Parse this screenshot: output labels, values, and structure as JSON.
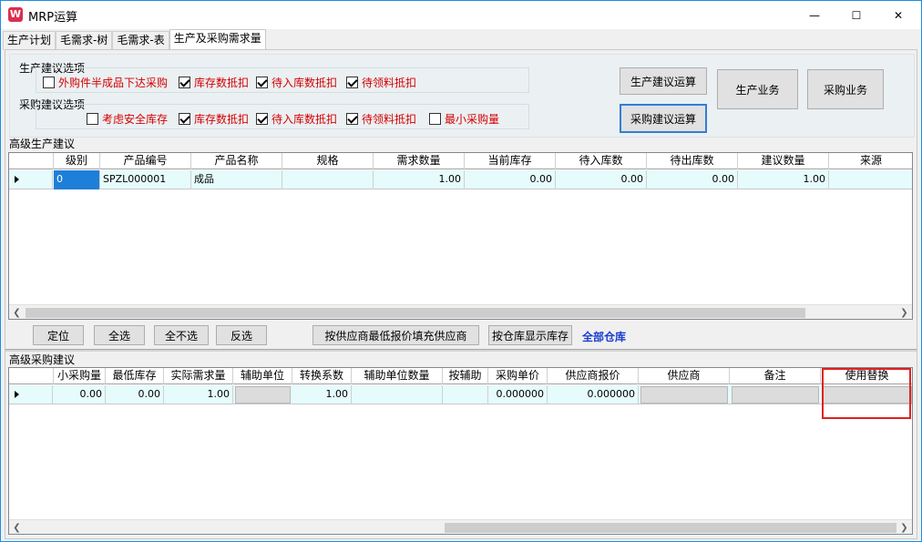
{
  "window": {
    "title": "MRP运算",
    "app_icon_glyph": "W",
    "controls": {
      "minimize": "—",
      "maximize": "☐",
      "close": "✕"
    }
  },
  "tabs": [
    {
      "label": "生产计划",
      "active": false
    },
    {
      "label": "毛需求-树",
      "active": false
    },
    {
      "label": "毛需求-表",
      "active": false
    },
    {
      "label": "生产及采购需求量",
      "active": true
    }
  ],
  "production_options": {
    "label": "生产建议选项",
    "items": [
      {
        "label": "外购件半成品下达采购",
        "checked": false
      },
      {
        "label": "库存数抵扣",
        "checked": true
      },
      {
        "label": "待入库数抵扣",
        "checked": true
      },
      {
        "label": "待领料抵扣",
        "checked": true
      }
    ]
  },
  "purchase_options": {
    "label": "采购建议选项",
    "items": [
      {
        "label": "考虑安全库存",
        "checked": false
      },
      {
        "label": "库存数抵扣",
        "checked": true
      },
      {
        "label": "待入库数抵扣",
        "checked": true
      },
      {
        "label": "待领料抵扣",
        "checked": true
      },
      {
        "label": "最小采购量",
        "checked": false
      }
    ]
  },
  "action_buttons": {
    "production_calc": "生产建议运算",
    "purchase_calc": "采购建议运算",
    "production_business": "生产业务",
    "purchase_business": "采购业务"
  },
  "production_section": {
    "label": "高级生产建议",
    "columns": [
      "级别",
      "产品编号",
      "产品名称",
      "规格",
      "需求数量",
      "当前库存",
      "待入库数",
      "待出库数",
      "建议数量",
      "来源"
    ],
    "rows": [
      [
        "0",
        "SPZL000001",
        "成品",
        "",
        "1.00",
        "0.00",
        "0.00",
        "0.00",
        "1.00",
        ""
      ]
    ]
  },
  "toolbar": {
    "locate": "定位",
    "select_all": "全选",
    "select_none": "全不选",
    "invert": "反选",
    "fill_supplier": "按供应商最低报价填充供应商",
    "show_stock": "按仓库显示库存",
    "warehouse": "全部仓库"
  },
  "purchase_section": {
    "label": "高级采购建议",
    "columns": [
      "小采购量",
      "最低库存",
      "实际需求量",
      "辅助单位",
      "转换系数",
      "辅助单位数量",
      "按辅助",
      "采购单价",
      "供应商报价",
      "供应商",
      "备注",
      "使用替换"
    ],
    "rows": [
      [
        "0.00",
        "0.00",
        "1.00",
        "",
        "1.00",
        "",
        "",
        "0.000000",
        "0.000000",
        "",
        "",
        ""
      ]
    ]
  },
  "scroll": {
    "left_arrow": "❮",
    "right_arrow": "❯"
  }
}
